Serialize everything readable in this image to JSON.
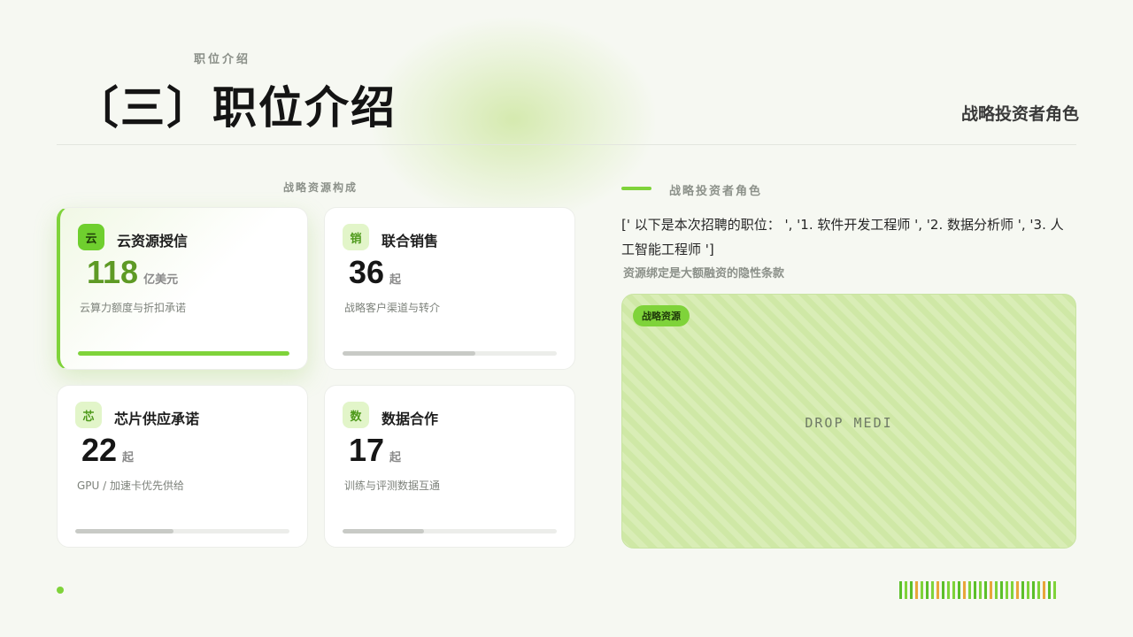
{
  "header": {
    "eyebrow": "职位介绍",
    "title": "〔三〕职位介绍",
    "top_right_label": "战略投资者角色"
  },
  "left_section": {
    "label": "战略资源构成",
    "cards": [
      {
        "badge": "云",
        "title": "云资源授信",
        "value": "118",
        "unit": "亿美元",
        "desc": "云算力额度与折扣承诺",
        "progress": 1.0,
        "active": true
      },
      {
        "badge": "销",
        "title": "联合销售",
        "value": "36",
        "unit": "起",
        "desc": "战略客户渠道与转介",
        "progress": 0.62,
        "active": false
      },
      {
        "badge": "芯",
        "title": "芯片供应承诺",
        "value": "22",
        "unit": "起",
        "desc": "GPU /  加速卡优先供给",
        "progress": 0.46,
        "active": false
      },
      {
        "badge": "数",
        "title": "数据合作",
        "value": "17",
        "unit": "起",
        "desc": "训练与评测数据互通",
        "progress": 0.38,
        "active": false
      }
    ]
  },
  "right_section": {
    "label": "战略投资者角色",
    "body": "[' 以下是本次招聘的职位： ', '1. 软件开发工程师 ', '2. 数据分析师 ', '3. 人工智能工程师 ']",
    "subtitle": "资源绑定是大额融资的隐性条款",
    "media_tag": "战略资源",
    "media_placeholder": "DROP MEDI"
  },
  "colors": {
    "accent": "#7fd33a",
    "accent_dark": "#5e9a25",
    "background": "#f6f8f2",
    "barcode": [
      "#5cbf2a",
      "#7fd33a",
      "#5cbf2a",
      "#e8a63a",
      "#7fd33a",
      "#5cbf2a",
      "#7fd33a",
      "#e8a63a",
      "#5cbf2a",
      "#7fd33a",
      "#7fd33a",
      "#5cbf2a",
      "#e8a63a",
      "#7fd33a",
      "#5cbf2a",
      "#7fd33a",
      "#5cbf2a",
      "#e8a63a",
      "#7fd33a",
      "#5cbf2a",
      "#7fd33a",
      "#7fd33a",
      "#e8a63a",
      "#5cbf2a",
      "#7fd33a",
      "#5cbf2a",
      "#7fd33a",
      "#e8a63a",
      "#5cbf2a",
      "#7fd33a"
    ]
  }
}
